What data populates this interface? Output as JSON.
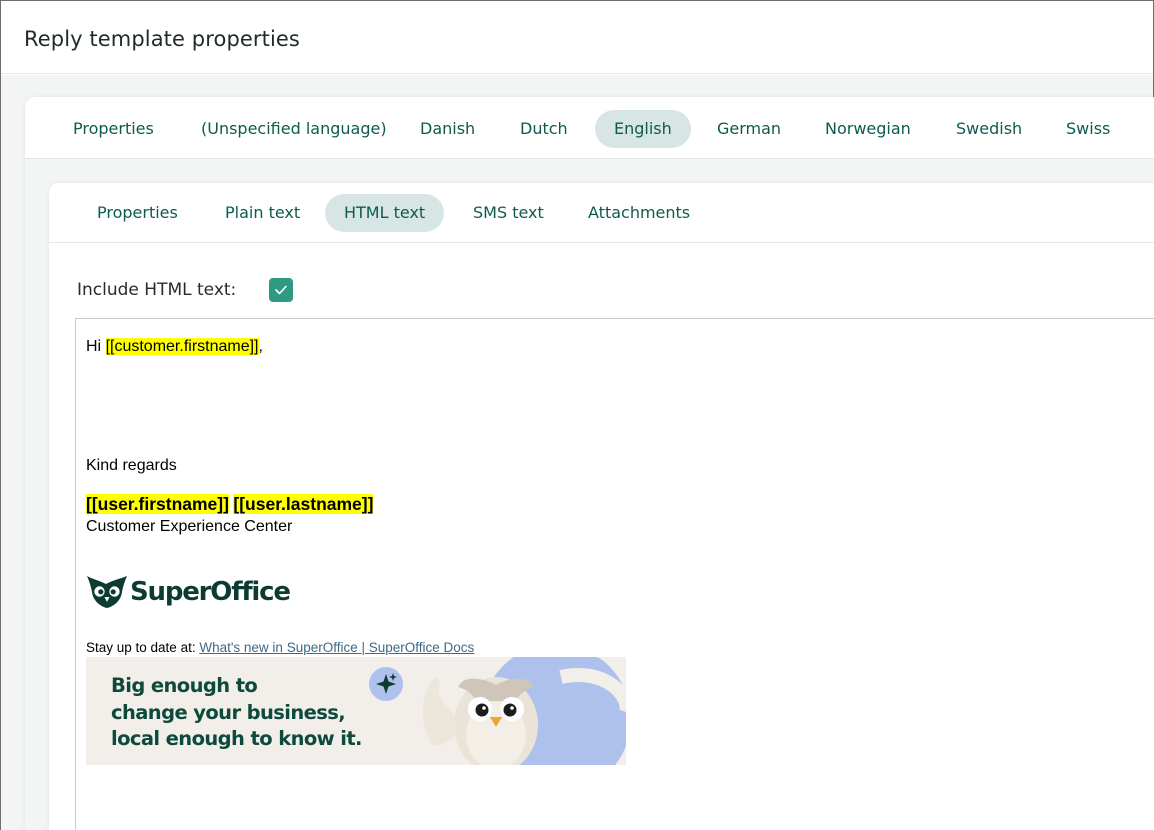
{
  "page": {
    "title": "Reply template properties"
  },
  "language_tabs": [
    {
      "label": "Properties",
      "active": false
    },
    {
      "label": "(Unspecified language)",
      "active": false
    },
    {
      "label": "Danish",
      "active": false
    },
    {
      "label": "Dutch",
      "active": false
    },
    {
      "label": "English",
      "active": true
    },
    {
      "label": "German",
      "active": false
    },
    {
      "label": "Norwegian",
      "active": false
    },
    {
      "label": "Swedish",
      "active": false
    },
    {
      "label": "Swiss",
      "active": false
    }
  ],
  "content_tabs": [
    {
      "label": "Properties",
      "active": false
    },
    {
      "label": "Plain text",
      "active": false
    },
    {
      "label": "HTML text",
      "active": true
    },
    {
      "label": "SMS text",
      "active": false
    },
    {
      "label": "Attachments",
      "active": false
    }
  ],
  "include_html": {
    "label": "Include HTML text:",
    "checked": true
  },
  "editor": {
    "greeting_prefix": "Hi ",
    "greeting_field": "[[customer.firstname]]",
    "greeting_suffix": ",",
    "closing": "Kind regards",
    "user_firstname": "[[user.firstname]]",
    "user_lastname": "[[user.lastname]]",
    "department": "Customer Experience Center",
    "logo_text": "SuperOffice",
    "stay_text": "Stay up to date at: ",
    "stay_link": "What's new in SuperOffice | SuperOffice Docs",
    "banner_lines": [
      "Big enough to",
      "change your business,",
      "local enough to know it."
    ]
  },
  "colors": {
    "accent": "#0e5b4d",
    "active_tab_bg": "#d7e6e4",
    "checkbox": "#2f9a83",
    "highlight": "#ffff00"
  }
}
